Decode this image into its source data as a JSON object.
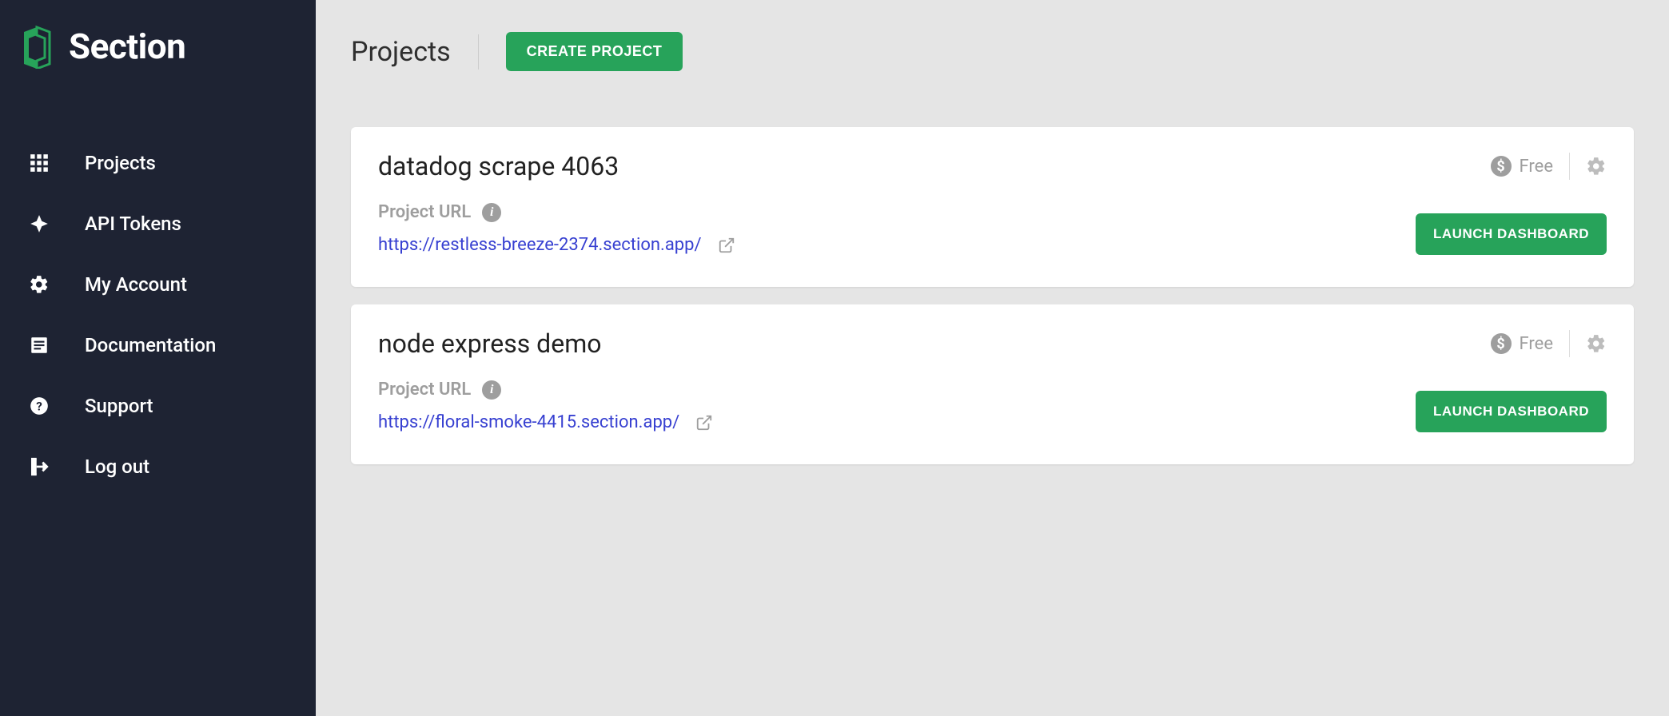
{
  "brand": {
    "name": "Section"
  },
  "sidebar": {
    "items": [
      {
        "label": "Projects"
      },
      {
        "label": "API Tokens"
      },
      {
        "label": "My Account"
      },
      {
        "label": "Documentation"
      },
      {
        "label": "Support"
      },
      {
        "label": "Log out"
      }
    ]
  },
  "header": {
    "title": "Projects",
    "create_label": "Create Project"
  },
  "labels": {
    "project_url": "Project URL",
    "launch": "Launch Dashboard"
  },
  "projects": [
    {
      "name": "datadog scrape 4063",
      "url": "https://restless-breeze-2374.section.app/",
      "plan": "Free"
    },
    {
      "name": "node express demo",
      "url": "https://floral-smoke-4415.section.app/",
      "plan": "Free"
    }
  ]
}
